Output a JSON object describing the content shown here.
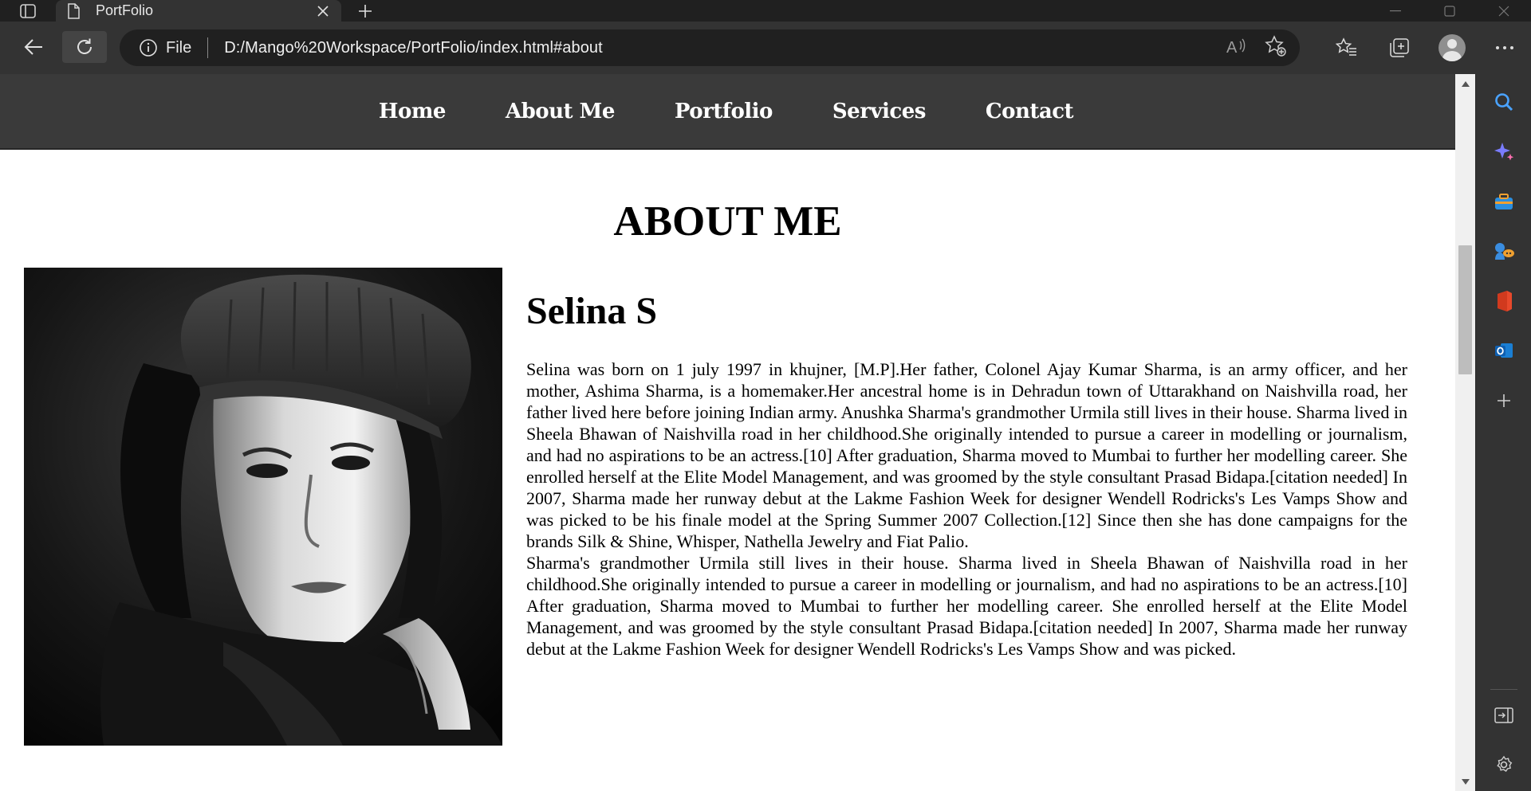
{
  "browser": {
    "tab_title": "PortFolio",
    "address": {
      "scheme_label": "File",
      "url": "D:/Mango%20Workspace/PortFolio/index.html#about"
    },
    "icons": {
      "tab_actions": "tab-actions-icon",
      "favicon": "page-icon",
      "tab_close": "close-icon",
      "new_tab": "plus-icon",
      "back": "arrow-left-icon",
      "reload": "reload-icon",
      "site_info": "info-icon",
      "read_aloud": "read-aloud-icon",
      "add_favorite": "star-add-icon",
      "favorites": "favorites-icon",
      "collections": "collections-icon",
      "profile": "profile-icon",
      "more": "more-icon"
    }
  },
  "site": {
    "nav": [
      "Home",
      "About Me",
      "Portfolio",
      "Services",
      "Contact"
    ],
    "section_heading": "ABOUT ME",
    "person_name": "Selina S",
    "bio_paragraphs": [
      "Selina was born on 1 july 1997 in khujner, [M.P].Her father, Colonel Ajay Kumar Sharma, is an army officer, and her mother, Ashima Sharma, is a homemaker.Her ancestral home is in Dehradun town of Uttarakhand on Naishvilla road, her father lived here before joining Indian army. Anushka Sharma's grandmother Urmila still lives in their house. Sharma lived in Sheela Bhawan of Naishvilla road in her childhood.She originally intended to pursue a career in modelling or journalism, and had no aspirations to be an actress.[10] After graduation, Sharma moved to Mumbai to further her modelling career. She enrolled herself at the Elite Model Management, and was groomed by the style consultant Prasad Bidapa.[citation needed] In 2007, Sharma made her runway debut at the Lakme Fashion Week for designer Wendell Rodricks's Les Vamps Show and was picked to be his finale model at the Spring Summer 2007 Collection.[12] Since then she has done campaigns for the brands Silk & Shine, Whisper, Nathella Jewelry and Fiat Palio.",
      "Sharma's grandmother Urmila still lives in their house. Sharma lived in Sheela Bhawan of Naishvilla road in her childhood.She originally intended to pursue a career in modelling or journalism, and had no aspirations to be an actress.[10] After graduation, Sharma moved to Mumbai to further her modelling career. She enrolled herself at the Elite Model Management, and was groomed by the style consultant Prasad Bidapa.[citation needed] In 2007, Sharma made her runway debut at the Lakme Fashion Week for designer Wendell Rodricks's Les Vamps Show and was picked."
    ]
  },
  "sidebar": {
    "items": [
      "search-icon",
      "copilot-icon",
      "tools-icon",
      "games-icon",
      "office-icon",
      "outlook-icon",
      "add-icon"
    ],
    "bottom": [
      "sidebar-collapse-icon",
      "settings-icon"
    ]
  },
  "colors": {
    "chrome_bg": "#202020",
    "toolbar_bg": "#333333",
    "site_nav_bg": "#3a3a3a",
    "page_bg": "#ffffff"
  }
}
